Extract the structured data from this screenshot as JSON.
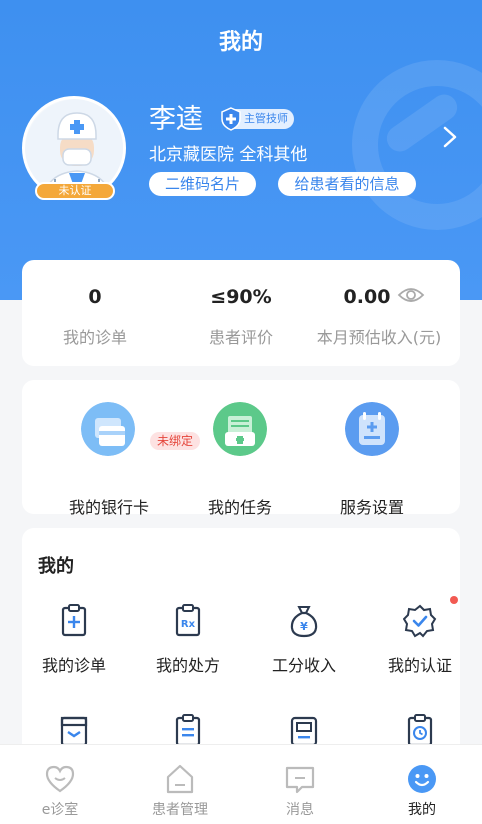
{
  "nav": {
    "title": "我的"
  },
  "profile": {
    "name": "李逵",
    "title_badge": "主管技师",
    "hospital": "北京藏医院 全科其他",
    "verify_status": "未认证",
    "qr_button": "二维码名片",
    "patient_info_button": "给患者看的信息"
  },
  "stats": [
    {
      "value": "0",
      "label": "我的诊单"
    },
    {
      "value": "≤90%",
      "label": "患者评价"
    },
    {
      "value": "0.00",
      "label": "本月预估收入(元)"
    }
  ],
  "quick_actions": [
    {
      "label": "我的银行卡",
      "icon": "bank-card-icon",
      "badge": "未绑定"
    },
    {
      "label": "我的任务",
      "icon": "task-icon"
    },
    {
      "label": "服务设置",
      "icon": "service-settings-icon"
    }
  ],
  "mine": {
    "title": "我的",
    "items": [
      {
        "label": "我的诊单",
        "icon": "clipboard-plus-icon"
      },
      {
        "label": "我的处方",
        "icon": "prescription-icon"
      },
      {
        "label": "工分收入",
        "icon": "money-bag-icon"
      },
      {
        "label": "我的认证",
        "icon": "verified-badge-icon"
      }
    ]
  },
  "tabs": [
    {
      "label": "e诊室",
      "icon": "heart-icon"
    },
    {
      "label": "患者管理",
      "icon": "home-icon"
    },
    {
      "label": "消息",
      "icon": "message-icon"
    },
    {
      "label": "我的",
      "icon": "smile-icon",
      "active": true
    }
  ],
  "colors": {
    "primary": "#4a98f5",
    "badge_orange": "#f4a83a",
    "alert_red": "#f25a52"
  }
}
